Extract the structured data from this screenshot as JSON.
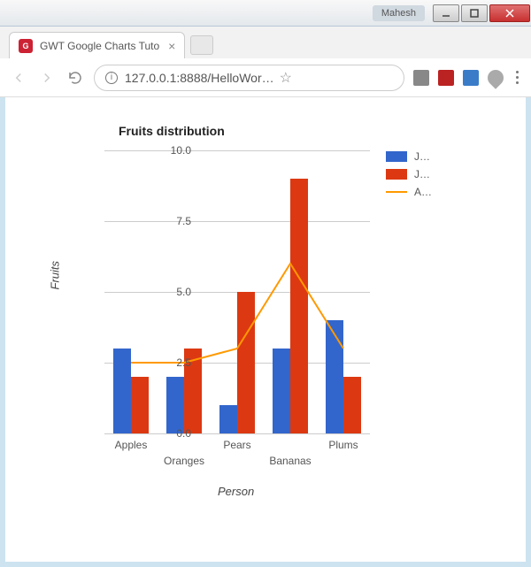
{
  "window": {
    "user_badge": "Mahesh"
  },
  "tab": {
    "title": "GWT Google Charts Tuto",
    "favicon_letter": "G"
  },
  "address": {
    "url": "127.0.0.1:8888/HelloWor…"
  },
  "legend": {
    "items": [
      {
        "label": "J…",
        "color": "#3366cc",
        "type": "bar"
      },
      {
        "label": "J…",
        "color": "#dc3912",
        "type": "bar"
      },
      {
        "label": "A…",
        "color": "#ff9900",
        "type": "line"
      }
    ]
  },
  "yticks": [
    "0.0",
    "2.5",
    "5.0",
    "7.5",
    "10.0"
  ],
  "chart_data": {
    "type": "bar+line",
    "title": "Fruits distribution",
    "xlabel": "Person",
    "ylabel": "Fruits",
    "ylim": [
      0,
      10
    ],
    "categories": [
      "Apples",
      "Oranges",
      "Pears",
      "Bananas",
      "Plums"
    ],
    "series": [
      {
        "name": "J…",
        "type": "bar",
        "color": "#3366cc",
        "values": [
          3,
          2,
          1,
          3,
          4
        ]
      },
      {
        "name": "J…",
        "type": "bar",
        "color": "#dc3912",
        "values": [
          2,
          3,
          5,
          9,
          2
        ]
      },
      {
        "name": "A…",
        "type": "line",
        "color": "#ff9900",
        "values": [
          2.5,
          2.5,
          3,
          6,
          3
        ]
      }
    ]
  }
}
